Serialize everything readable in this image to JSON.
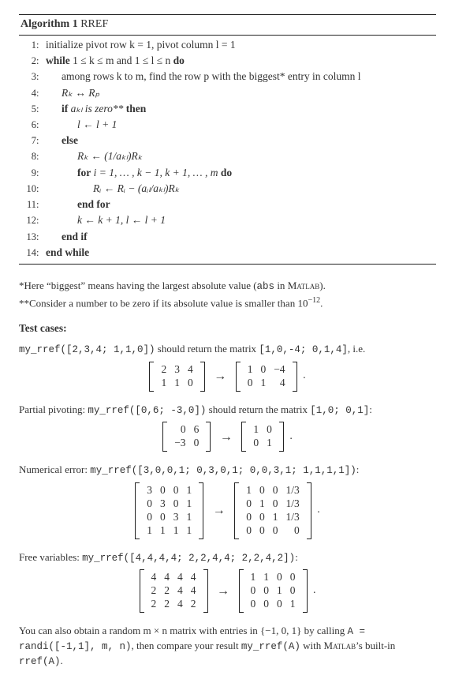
{
  "algorithm": {
    "title_prefix": "Algorithm 1",
    "title_name": "RREF",
    "lines": {
      "l1": "initialize pivot row k = 1, pivot column l = 1",
      "l2_a": "while",
      "l2_b": "1 ≤ k ≤ m and 1 ≤ l ≤ n",
      "l2_c": "do",
      "l3": "among rows k to m, find the row p with the biggest* entry in column l",
      "l4": "Rₖ ↔ Rₚ",
      "l5_a": "if",
      "l5_b": "aₖₗ is zero**",
      "l5_c": "then",
      "l6": "l ← l + 1",
      "l7": "else",
      "l8": "Rₖ ← (1/aₖₗ)Rₖ",
      "l9_a": "for",
      "l9_b": "i = 1, … , k − 1, k + 1, … , m",
      "l9_c": "do",
      "l10": "Rᵢ ← Rᵢ − (aᵢₗ/aₖₗ)Rₖ",
      "l11": "end for",
      "l12": "k ← k + 1, l ← l + 1",
      "l13": "end if",
      "l14": "end while"
    }
  },
  "notes": {
    "star": "*Here “biggest” means having the largest absolute value (",
    "star_code": "abs",
    "star_tail": " in ",
    "star_matlab": "Matlab",
    "star_end": ").",
    "dstar": "**Consider a number to be zero if its absolute value is smaller than 10",
    "dstar_exp": "−12",
    "dstar_end": "."
  },
  "tests": {
    "heading": "Test cases:",
    "c1_pre": "my_rref([2,3,4; 1,1,0])",
    "c1_mid": " should return the matrix ",
    "c1_res": "[1,0,-4; 0,1,4]",
    "c1_tail": ", i.e.",
    "m1_in": [
      [
        "2",
        "3",
        "4"
      ],
      [
        "1",
        "1",
        "0"
      ]
    ],
    "m1_out": [
      [
        "1",
        "0",
        "−4"
      ],
      [
        "0",
        "1",
        "4"
      ]
    ],
    "c2_label": "Partial pivoting: ",
    "c2_code": "my_rref([0,6; -3,0])",
    "c2_mid": " should return the matrix ",
    "c2_res": "[1,0; 0,1]",
    "c2_tail": ":",
    "m2_in": [
      [
        "0",
        "6"
      ],
      [
        "−3",
        "0"
      ]
    ],
    "m2_out": [
      [
        "1",
        "0"
      ],
      [
        "0",
        "1"
      ]
    ],
    "c3_label": "Numerical error: ",
    "c3_code": "my_rref([3,0,0,1; 0,3,0,1; 0,0,3,1; 1,1,1,1])",
    "c3_tail": ":",
    "m3_in": [
      [
        "3",
        "0",
        "0",
        "1"
      ],
      [
        "0",
        "3",
        "0",
        "1"
      ],
      [
        "0",
        "0",
        "3",
        "1"
      ],
      [
        "1",
        "1",
        "1",
        "1"
      ]
    ],
    "m3_out": [
      [
        "1",
        "0",
        "0",
        "1/3"
      ],
      [
        "0",
        "1",
        "0",
        "1/3"
      ],
      [
        "0",
        "0",
        "1",
        "1/3"
      ],
      [
        "0",
        "0",
        "0",
        "0"
      ]
    ],
    "c4_label": "Free variables: ",
    "c4_code": "my_rref([4,4,4,4; 2,2,4,4; 2,2,4,2])",
    "c4_tail": ":",
    "m4_in": [
      [
        "4",
        "4",
        "4",
        "4"
      ],
      [
        "2",
        "2",
        "4",
        "4"
      ],
      [
        "2",
        "2",
        "4",
        "2"
      ]
    ],
    "m4_out": [
      [
        "1",
        "1",
        "0",
        "0"
      ],
      [
        "0",
        "0",
        "1",
        "0"
      ],
      [
        "0",
        "0",
        "0",
        "1"
      ]
    ]
  },
  "final": {
    "p1a": "You can also obtain a random m × n matrix with entries in {−1, 0, 1} by calling ",
    "p1code": "A = randi([-1,1], m, n)",
    "p1b": ", then compare your result ",
    "p1code2": "my_rref(A)",
    "p1c": " with ",
    "p1matlab": "Matlab",
    "p1d": "’s built-in ",
    "p1code3": "rref(A)",
    "p1e": "."
  }
}
